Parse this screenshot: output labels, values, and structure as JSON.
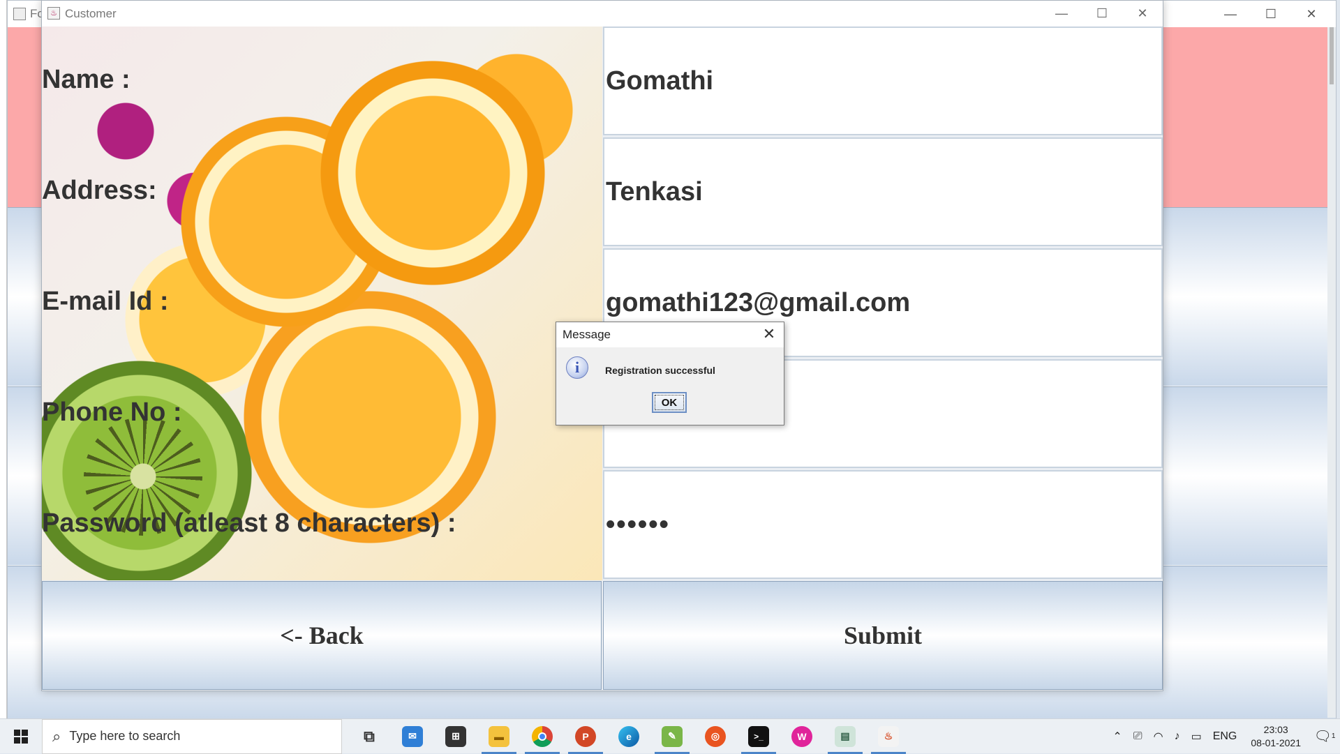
{
  "background_window": {
    "title": "Fo"
  },
  "window": {
    "title": "Customer",
    "controls": {
      "minimize": "—",
      "maximize": "☐",
      "close": "✕"
    }
  },
  "form": {
    "labels": {
      "name": "Name :",
      "address": "Address:",
      "email": "E-mail Id :",
      "phone": "Phone No :",
      "password": "Password (atleast 8 characters) :"
    },
    "values": {
      "name": "Gomathi",
      "address": "Tenkasi",
      "email": "gomathi123@gmail.com",
      "phone": "",
      "password": "••••••"
    },
    "buttons": {
      "back": "<- Back",
      "submit": "Submit"
    }
  },
  "dialog": {
    "title": "Message",
    "message": "Registration successful",
    "ok_label": "OK",
    "close": "✕",
    "info_glyph": "i"
  },
  "taskbar": {
    "search_placeholder": "Type here to search",
    "apps": [
      "task-view",
      "mail",
      "store",
      "file-explorer",
      "chrome",
      "powerpoint",
      "edge",
      "notepad-plus",
      "ubuntu",
      "terminal",
      "wamp",
      "app-window",
      "java"
    ],
    "language": "ENG",
    "time": "23:03",
    "date": "08-01-2021",
    "notification_count": "1"
  }
}
